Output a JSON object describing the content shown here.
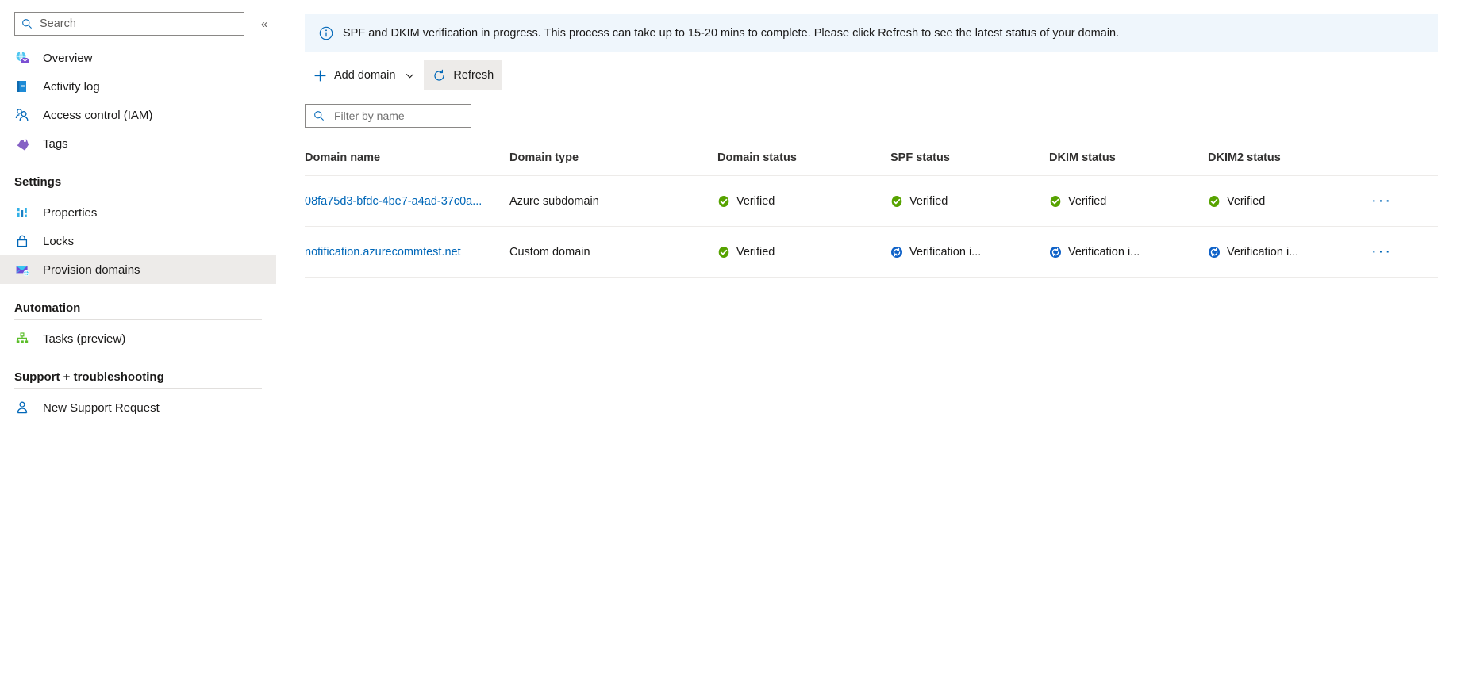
{
  "sidebar": {
    "search": {
      "placeholder": "Search",
      "value": ""
    },
    "collapse_label": "«",
    "top_items": [
      {
        "label": "Overview",
        "icon": "globe-envelope-icon"
      },
      {
        "label": "Activity log",
        "icon": "activity-log-icon"
      },
      {
        "label": "Access control (IAM)",
        "icon": "people-icon"
      },
      {
        "label": "Tags",
        "icon": "tag-icon"
      }
    ],
    "groups": [
      {
        "title": "Settings",
        "items": [
          {
            "label": "Properties",
            "icon": "properties-icon",
            "selected": false
          },
          {
            "label": "Locks",
            "icon": "lock-icon",
            "selected": false
          },
          {
            "label": "Provision domains",
            "icon": "envelope-domain-icon",
            "selected": true
          }
        ]
      },
      {
        "title": "Automation",
        "items": [
          {
            "label": "Tasks (preview)",
            "icon": "tasks-icon",
            "selected": false
          }
        ]
      },
      {
        "title": "Support + troubleshooting",
        "items": [
          {
            "label": "New Support Request",
            "icon": "support-person-icon",
            "selected": false
          }
        ]
      }
    ]
  },
  "banner": {
    "icon": "info-icon",
    "text": "SPF and DKIM verification in progress. This process can take up to 15-20 mins to complete. Please click Refresh to see the latest status of your domain."
  },
  "toolbar": {
    "add_domain_label": "Add domain",
    "add_domain_icon": "plus-icon",
    "add_domain_chevron": "chevron-down-icon",
    "refresh_label": "Refresh",
    "refresh_icon": "refresh-icon"
  },
  "filter": {
    "placeholder": "Filter by name",
    "value": "",
    "icon": "search-icon"
  },
  "table": {
    "columns": [
      "Domain name",
      "Domain type",
      "Domain status",
      "SPF status",
      "DKIM status",
      "DKIM2 status"
    ],
    "rows": [
      {
        "domain_name": "08fa75d3-bfdc-4be7-a4ad-37c0a...",
        "domain_type": "Azure subdomain",
        "domain_status": "Verified",
        "domain_status_icon": "verified-check-icon",
        "spf_status": "Verified",
        "spf_status_icon": "verified-check-icon",
        "dkim_status": "Verified",
        "dkim_status_icon": "verified-check-icon",
        "dkim2_status": "Verified",
        "dkim2_status_icon": "verified-check-icon",
        "menu_label": "···"
      },
      {
        "domain_name": "notification.azurecommtest.net",
        "domain_type": "Custom domain",
        "domain_status": "Verified",
        "domain_status_icon": "verified-check-icon",
        "spf_status": "Verification i...",
        "spf_status_icon": "in-progress-icon",
        "dkim_status": "Verification i...",
        "dkim_status_icon": "in-progress-icon",
        "dkim2_status": "Verification i...",
        "dkim2_status_icon": "in-progress-icon",
        "menu_label": "···"
      }
    ]
  },
  "colors": {
    "link": "#0067b8",
    "verified_green": "#57a300",
    "in_progress_blue": "#0078d4",
    "banner_bg": "#eff6fc",
    "selected_nav": "#edebe9"
  }
}
